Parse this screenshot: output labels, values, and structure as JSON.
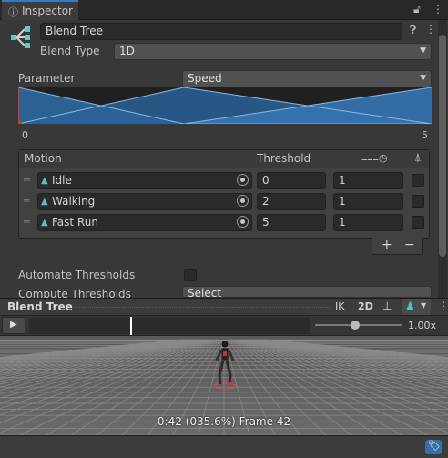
{
  "window": {
    "tab_label": "Inspector"
  },
  "header": {
    "name_value": "Blend Tree",
    "blend_type_label": "Blend Type",
    "blend_type_value": "1D"
  },
  "parameter": {
    "label": "Parameter",
    "value": "Speed",
    "range_min": "0",
    "range_max": "5"
  },
  "motion_table": {
    "col_motion": "Motion",
    "col_threshold": "Threshold",
    "rows": [
      {
        "motion": "Idle",
        "threshold": "0",
        "speed": "1",
        "mirror": false
      },
      {
        "motion": "Walking",
        "threshold": "2",
        "speed": "1",
        "mirror": false
      },
      {
        "motion": "Fast Run",
        "threshold": "5",
        "speed": "1",
        "mirror": false
      }
    ],
    "add_label": "+",
    "remove_label": "−"
  },
  "options": {
    "automate_label": "Automate Thresholds",
    "automate_checked": false,
    "compute_label": "Compute Thresholds",
    "compute_value": "Select"
  },
  "preview": {
    "title": "Blend Tree",
    "ik_label": "IK",
    "mode_label": "2D",
    "speed_readout": "1.00x",
    "speed_fraction": 0.45,
    "status_text": "0:42 (035.6%) Frame 42"
  },
  "colors": {
    "accent": "#3a79bb",
    "blend_fill": "#2f6ea8",
    "anim_icon": "#59c1b8"
  }
}
